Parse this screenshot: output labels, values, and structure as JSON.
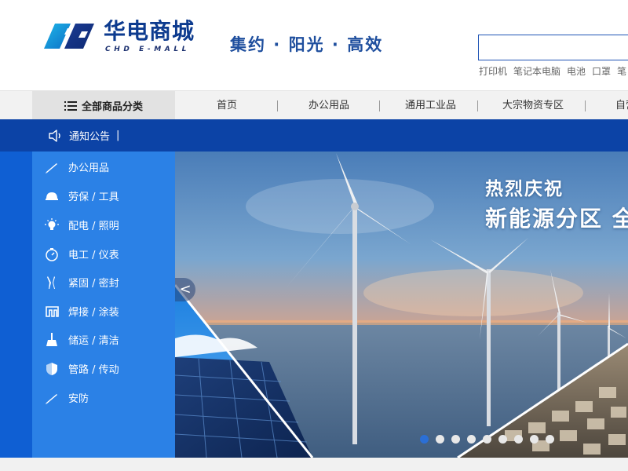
{
  "brand": {
    "name_cn": "华电商城",
    "name_en": "CHD E-MALL",
    "slogan": "集约 · 阳光 · 高效"
  },
  "search": {
    "placeholder": "",
    "hotwords": [
      "打印机",
      "笔记本电脑",
      "电池",
      "口罩",
      "笔"
    ]
  },
  "nav": {
    "category_label": "全部商品分类",
    "items": [
      "首页",
      "办公用品",
      "通用工业品",
      "大宗物资专区",
      "自营"
    ]
  },
  "notice": {
    "label": "通知公告",
    "cursor": "|"
  },
  "sidebar": {
    "items": [
      {
        "label": "办公用品",
        "icon": "pen-icon"
      },
      {
        "label": "劳保 / 工具",
        "icon": "helmet-icon"
      },
      {
        "label": "配电 / 照明",
        "icon": "bulb-icon"
      },
      {
        "label": "电工 / 仪表",
        "icon": "gauge-icon"
      },
      {
        "label": "紧固 / 密封",
        "icon": "pliers-icon"
      },
      {
        "label": "焊接 / 涂装",
        "icon": "weld-icon"
      },
      {
        "label": "储运 / 清洁",
        "icon": "broom-icon"
      },
      {
        "label": "管路 / 传动",
        "icon": "shield-icon"
      },
      {
        "label": "安防",
        "icon": "pen-icon"
      }
    ]
  },
  "banner": {
    "line1": "热烈庆祝",
    "line2": "新能源分区 全",
    "prev": "<",
    "dot_count": 9,
    "active_dot": 0
  },
  "colors": {
    "brand_blue": "#0c43a6",
    "sidebar_blue": "#2b81e6",
    "deep_blue": "#0f5fd3",
    "active_dot": "#2b6fd6"
  }
}
